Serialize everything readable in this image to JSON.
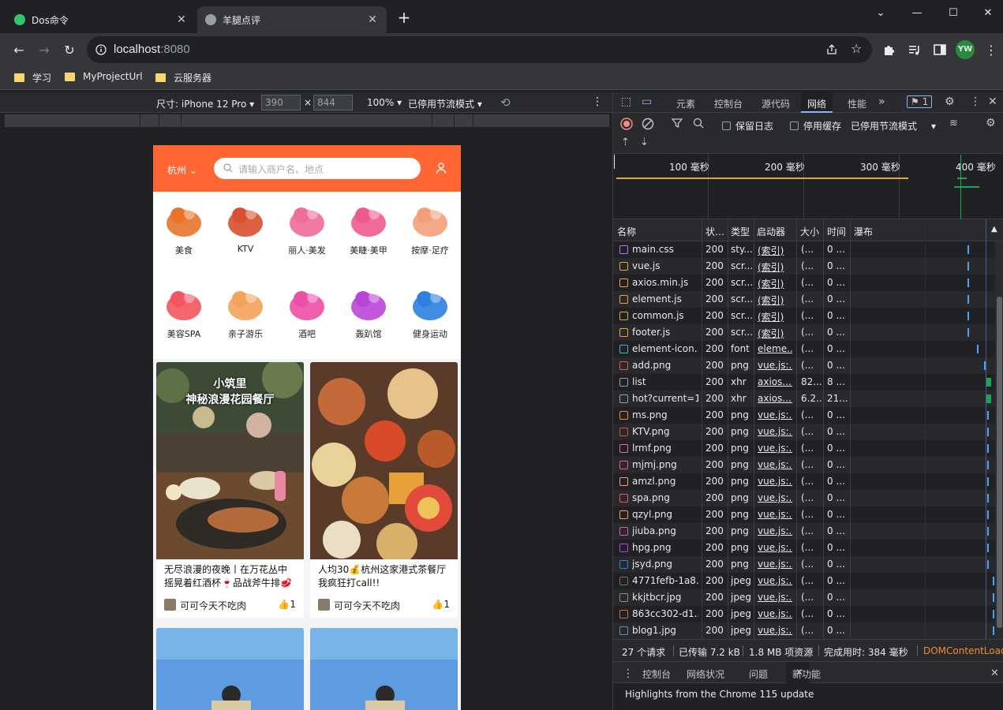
{
  "browser": {
    "tabs": [
      {
        "title": "Dos命令",
        "favicon_color": "#34c46f",
        "active": false
      },
      {
        "title": "羊腿点评",
        "favicon_color": "#9aa0a6",
        "active": true
      }
    ],
    "new_tab_label": "+",
    "window_controls": {
      "collapse": "⌄",
      "minimize": "—",
      "maximize": "☐",
      "close": "✕"
    },
    "url_host": "localhost",
    "url_port": ":8080",
    "profile_initials": "YW",
    "bookmarks": [
      "学习",
      "MyProjectUrl",
      "云服务器"
    ]
  },
  "device_toolbar": {
    "dimensions_label": "尺寸: iPhone 12 Pro",
    "width": "390",
    "times": "×",
    "height": "844",
    "zoom": "100%",
    "throttle": "已停用节流模式"
  },
  "app": {
    "city": "杭州",
    "search_placeholder": "请输入商户名、地点",
    "categories": [
      {
        "label": "美食",
        "icon": "roast-chicken-icon",
        "color": "#e8742a"
      },
      {
        "label": "KTV",
        "icon": "microphone-icon",
        "color": "#d8502e"
      },
      {
        "label": "丽人·美发",
        "icon": "hair-icon",
        "color": "#f06c9a"
      },
      {
        "label": "美睫·美甲",
        "icon": "nail-icon",
        "color": "#ee5a8f"
      },
      {
        "label": "按摩·足疗",
        "icon": "massage-hand-icon",
        "color": "#f3a07a"
      },
      {
        "label": "美容SPA",
        "icon": "face-mask-icon",
        "color": "#f2555e"
      },
      {
        "label": "亲子游乐",
        "icon": "parent-child-icon",
        "color": "#f3a35a"
      },
      {
        "label": "酒吧",
        "icon": "cocktail-icon",
        "color": "#ec4fa5"
      },
      {
        "label": "轰趴馆",
        "icon": "party-mask-icon",
        "color": "#b945d8"
      },
      {
        "label": "健身运动",
        "icon": "dumbbell-icon",
        "color": "#2f7fe0"
      }
    ],
    "cards": [
      {
        "title": "无尽浪漫的夜晚丨在万花丛中摇晃着红酒杯🍷品战斧牛排🥩",
        "image_caption": "小筑里\n神秘浪漫花园餐厅",
        "author": "可可今天不吃肉",
        "likes": "1"
      },
      {
        "title": "人均30💰杭州这家港式茶餐厅我疯狂打call!!",
        "image_caption": "",
        "author": "可可今天不吃肉",
        "likes": "1"
      }
    ]
  },
  "devtools": {
    "tabs": [
      "元素",
      "控制台",
      "源代码",
      "网络",
      "性能"
    ],
    "more": "»",
    "issues_count": "1",
    "preserve_log": "保留日志",
    "disable_cache": "停用缓存",
    "throttle": "已停用节流模式",
    "timeline_labels": [
      "100 毫秒",
      "200 毫秒",
      "300 毫秒",
      "400 毫秒"
    ],
    "columns": [
      "名称",
      "状…",
      "类型",
      "启动器",
      "大小",
      "时间",
      "瀑布"
    ],
    "rows": [
      {
        "name": "main.css",
        "status": "200",
        "type": "sty...",
        "initiator": "(索引)",
        "size": "(...",
        "time": "0 ...",
        "icon_color": "#b47be8"
      },
      {
        "name": "vue.js",
        "status": "200",
        "type": "scr...",
        "initiator": "(索引)",
        "size": "(...",
        "time": "0 ...",
        "icon_color": "#f0a33a"
      },
      {
        "name": "axios.min.js",
        "status": "200",
        "type": "scr...",
        "initiator": "(索引)",
        "size": "(...",
        "time": "0 ...",
        "icon_color": "#f0a33a"
      },
      {
        "name": "element.js",
        "status": "200",
        "type": "scr...",
        "initiator": "(索引)",
        "size": "(...",
        "time": "0 ...",
        "icon_color": "#f0a33a"
      },
      {
        "name": "common.js",
        "status": "200",
        "type": "scr...",
        "initiator": "(索引)",
        "size": "(...",
        "time": "0 ...",
        "icon_color": "#f0a33a"
      },
      {
        "name": "footer.js",
        "status": "200",
        "type": "scr...",
        "initiator": "(索引)",
        "size": "(...",
        "time": "0 ...",
        "icon_color": "#f0a33a"
      },
      {
        "name": "element-icon...",
        "status": "200",
        "type": "font",
        "initiator": "eleme...",
        "size": "(...",
        "time": "0 ...",
        "icon_color": "#4ab0c8"
      },
      {
        "name": "add.png",
        "status": "200",
        "type": "png",
        "initiator": "vue.js:...",
        "size": "(...",
        "time": "0 ...",
        "icon_color": "#e65a3a"
      },
      {
        "name": "list",
        "status": "200",
        "type": "xhr",
        "initiator": "axios....",
        "size": "82...",
        "time": "8 ...",
        "icon_color": "#9aa0a6"
      },
      {
        "name": "hot?current=1",
        "status": "200",
        "type": "xhr",
        "initiator": "axios....",
        "size": "6.2...",
        "time": "21...",
        "icon_color": "#9aa0a6"
      },
      {
        "name": "ms.png",
        "status": "200",
        "type": "png",
        "initiator": "vue.js:...",
        "size": "(...",
        "time": "0 ...",
        "icon_color": "#e88a3a"
      },
      {
        "name": "KTV.png",
        "status": "200",
        "type": "png",
        "initiator": "vue.js:...",
        "size": "(...",
        "time": "0 ...",
        "icon_color": "#d8502e"
      },
      {
        "name": "lrmf.png",
        "status": "200",
        "type": "png",
        "initiator": "vue.js:...",
        "size": "(...",
        "time": "0 ...",
        "icon_color": "#f06c9a"
      },
      {
        "name": "mjmj.png",
        "status": "200",
        "type": "png",
        "initiator": "vue.js:...",
        "size": "(...",
        "time": "0 ...",
        "icon_color": "#ee5a8f"
      },
      {
        "name": "amzl.png",
        "status": "200",
        "type": "png",
        "initiator": "vue.js:...",
        "size": "(...",
        "time": "0 ...",
        "icon_color": "#f3a07a"
      },
      {
        "name": "spa.png",
        "status": "200",
        "type": "png",
        "initiator": "vue.js:...",
        "size": "(...",
        "time": "0 ...",
        "icon_color": "#f2555e"
      },
      {
        "name": "qzyl.png",
        "status": "200",
        "type": "png",
        "initiator": "vue.js:...",
        "size": "(...",
        "time": "0 ...",
        "icon_color": "#f3a35a"
      },
      {
        "name": "jiuba.png",
        "status": "200",
        "type": "png",
        "initiator": "vue.js:...",
        "size": "(...",
        "time": "0 ...",
        "icon_color": "#ec4fa5"
      },
      {
        "name": "hpg.png",
        "status": "200",
        "type": "png",
        "initiator": "vue.js:...",
        "size": "(...",
        "time": "0 ...",
        "icon_color": "#b945d8"
      },
      {
        "name": "jsyd.png",
        "status": "200",
        "type": "png",
        "initiator": "vue.js:...",
        "size": "(...",
        "time": "0 ...",
        "icon_color": "#2f7fe0"
      },
      {
        "name": "4771fefb-1a8...",
        "status": "200",
        "type": "jpeg",
        "initiator": "vue.js:...",
        "size": "(...",
        "time": "0 ...",
        "icon_color": "#8a6a4a"
      },
      {
        "name": "kkjtbcr.jpg",
        "status": "200",
        "type": "jpeg",
        "initiator": "vue.js:...",
        "size": "(...",
        "time": "0 ...",
        "icon_color": "#9a8a7a"
      },
      {
        "name": "863cc302-d1...",
        "status": "200",
        "type": "jpeg",
        "initiator": "vue.js:...",
        "size": "(...",
        "time": "0 ...",
        "icon_color": "#c0734a"
      },
      {
        "name": "blog1.jpg",
        "status": "200",
        "type": "jpeg",
        "initiator": "vue.js:...",
        "size": "(...",
        "time": "0 ...",
        "icon_color": "#6a8ab8"
      }
    ],
    "status_bar": {
      "requests": "27 个请求",
      "transferred": "已传输 7.2 kB",
      "resources": "1.8 MB 项资源",
      "finish": "完成用时: 384 毫秒",
      "dcl": "DOMContentLoaded"
    },
    "drawer_tabs": [
      "控制台",
      "网络状况",
      "问题",
      "新功能"
    ],
    "drawer_message": "Highlights from the Chrome 115 update"
  },
  "colors": {
    "app_orange": "#ff6633",
    "dcl_orange": "#f28b2c",
    "timeline_orange": "#e8a33a",
    "timeline_green": "#1ea45a",
    "waterfall_blue": "#4fa3f7"
  }
}
